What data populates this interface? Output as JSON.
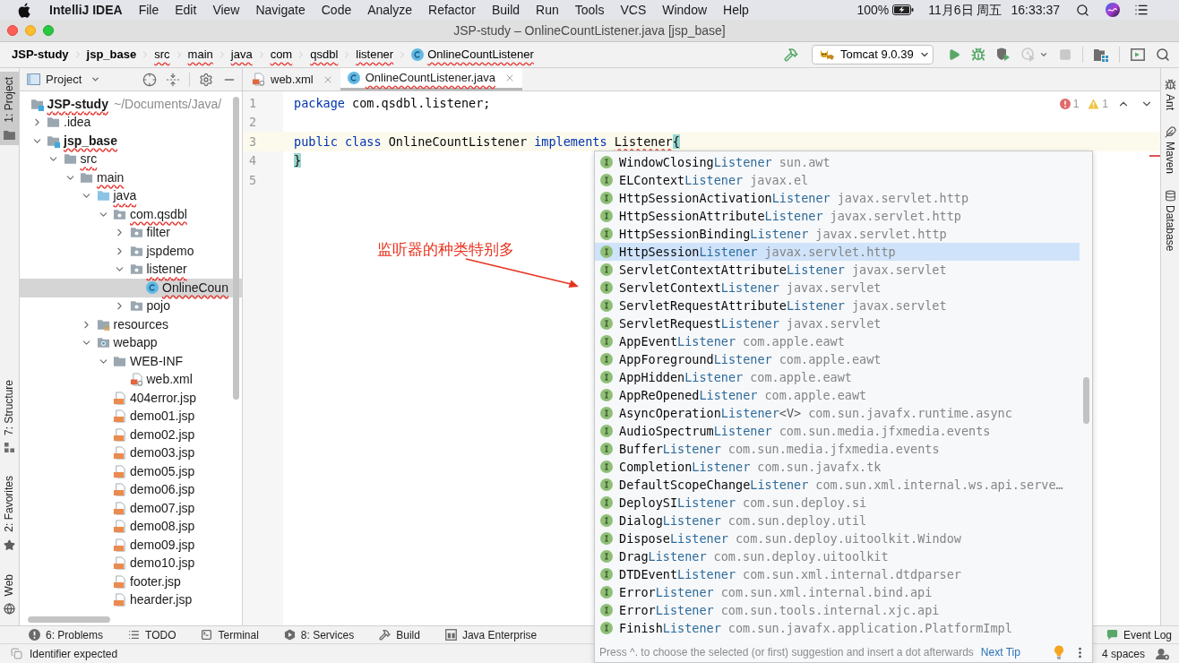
{
  "menu_bar": {
    "app": "IntelliJ IDEA",
    "items": [
      "File",
      "Edit",
      "View",
      "Navigate",
      "Code",
      "Analyze",
      "Refactor",
      "Build",
      "Run",
      "Tools",
      "VCS",
      "Window",
      "Help"
    ],
    "battery": "100%",
    "date": "11月6日 周五",
    "time": "16:33:37"
  },
  "window": {
    "title": "JSP-study – OnlineCountListener.java [jsp_base]"
  },
  "breadcrumbs": [
    {
      "label": "JSP-study",
      "kind": "module",
      "error": false
    },
    {
      "label": "jsp_base",
      "kind": "module",
      "error": false
    },
    {
      "label": "src",
      "kind": "folder",
      "error": true
    },
    {
      "label": "main",
      "kind": "folder",
      "error": true
    },
    {
      "label": "java",
      "kind": "folder",
      "error": true
    },
    {
      "label": "com",
      "kind": "folder",
      "error": true
    },
    {
      "label": "qsdbl",
      "kind": "folder",
      "error": true
    },
    {
      "label": "listener",
      "kind": "folder",
      "error": true
    },
    {
      "label": "OnlineCountListener",
      "kind": "class",
      "error": true
    }
  ],
  "toolbar": [
    {
      "kind": "build",
      "disabled": false
    },
    {
      "kind": "run-config",
      "label": "Tomcat 9.0.39",
      "disabled": false
    },
    {
      "kind": "run",
      "disabled": false
    },
    {
      "kind": "debug",
      "disabled": false
    },
    {
      "kind": "coverage",
      "disabled": false
    },
    {
      "kind": "profile",
      "disabled": true
    },
    {
      "kind": "stop",
      "disabled": true
    },
    {
      "kind": "project-structure",
      "disabled": false
    },
    {
      "kind": "run-window",
      "disabled": false
    },
    {
      "kind": "search",
      "disabled": false
    }
  ],
  "left_strip": {
    "top": [
      {
        "label": "1: Project",
        "kind": "project",
        "selected": true
      }
    ],
    "bottom": [
      {
        "label": "7: Structure",
        "kind": "structure",
        "selected": false
      },
      {
        "label": "2: Favorites",
        "kind": "favorites",
        "selected": false
      },
      {
        "label": "Web",
        "kind": "web",
        "selected": false
      }
    ]
  },
  "project_panel": {
    "title": "Project",
    "tree": [
      {
        "label": "JSP-study",
        "note": "~/Documents/Java/",
        "kind": "module",
        "selected": false,
        "error": true,
        "children": [
          {
            "label": ".idea",
            "kind": "folder",
            "expanded": false,
            "selected": false,
            "error": false
          },
          {
            "label": "jsp_base",
            "kind": "module",
            "expanded": true,
            "selected": false,
            "error": true,
            "children": [
              {
                "label": "src",
                "kind": "folder",
                "expanded": true,
                "selected": false,
                "error": true,
                "children": [
                  {
                    "label": "main",
                    "kind": "folder",
                    "expanded": true,
                    "selected": false,
                    "error": true,
                    "children": [
                      {
                        "label": "java",
                        "kind": "source-root",
                        "expanded": true,
                        "selected": false,
                        "error": true,
                        "children": [
                          {
                            "label": "com.qsdbl",
                            "kind": "package",
                            "expanded": true,
                            "selected": false,
                            "error": true,
                            "children": [
                              {
                                "label": "filter",
                                "kind": "package",
                                "expanded": false,
                                "selected": false,
                                "error": false
                              },
                              {
                                "label": "jspdemo",
                                "kind": "package",
                                "expanded": false,
                                "selected": false,
                                "error": false
                              },
                              {
                                "label": "listener",
                                "kind": "package",
                                "expanded": true,
                                "selected": false,
                                "error": true,
                                "children": [
                                  {
                                    "label": "OnlineCoun",
                                    "kind": "class",
                                    "selected": true,
                                    "error": true
                                  }
                                ]
                              },
                              {
                                "label": "pojo",
                                "kind": "package",
                                "expanded": false,
                                "selected": false,
                                "error": false
                              }
                            ]
                          }
                        ]
                      },
                      {
                        "label": "resources",
                        "kind": "resources-root",
                        "expanded": false,
                        "selected": false,
                        "error": false
                      },
                      {
                        "label": "webapp",
                        "kind": "web-root",
                        "expanded": true,
                        "selected": false,
                        "error": false,
                        "children": [
                          {
                            "label": "WEB-INF",
                            "kind": "folder",
                            "expanded": true,
                            "selected": false,
                            "error": false,
                            "children": [
                              {
                                "label": "web.xml",
                                "kind": "xml",
                                "selected": false,
                                "error": false
                              }
                            ]
                          },
                          {
                            "label": "404error.jsp",
                            "kind": "jsp",
                            "selected": false,
                            "error": false
                          },
                          {
                            "label": "demo01.jsp",
                            "kind": "jsp",
                            "selected": false,
                            "error": false
                          },
                          {
                            "label": "demo02.jsp",
                            "kind": "jsp",
                            "selected": false,
                            "error": false
                          },
                          {
                            "label": "demo03.jsp",
                            "kind": "jsp",
                            "selected": false,
                            "error": false
                          },
                          {
                            "label": "demo05.jsp",
                            "kind": "jsp",
                            "selected": false,
                            "error": false
                          },
                          {
                            "label": "demo06.jsp",
                            "kind": "jsp",
                            "selected": false,
                            "error": false
                          },
                          {
                            "label": "demo07.jsp",
                            "kind": "jsp",
                            "selected": false,
                            "error": false
                          },
                          {
                            "label": "demo08.jsp",
                            "kind": "jsp",
                            "selected": false,
                            "error": false
                          },
                          {
                            "label": "demo09.jsp",
                            "kind": "jsp",
                            "selected": false,
                            "error": false
                          },
                          {
                            "label": "demo10.jsp",
                            "kind": "jsp",
                            "selected": false,
                            "error": false
                          },
                          {
                            "label": "footer.jsp",
                            "kind": "jsp",
                            "selected": false,
                            "error": false
                          },
                          {
                            "label": "hearder.jsp",
                            "kind": "jsp",
                            "selected": false,
                            "error": false
                          }
                        ]
                      }
                    ]
                  }
                ]
              }
            ]
          }
        ]
      }
    ]
  },
  "editor_tabs": [
    {
      "label": "web.xml",
      "kind": "xml",
      "selected": false,
      "error": false
    },
    {
      "label": "OnlineCountListener.java",
      "kind": "class",
      "selected": true,
      "error": true
    }
  ],
  "editor": {
    "errors": "1",
    "warnings": "1",
    "lines": [
      {
        "number": "1",
        "current": false,
        "tokens": [
          {
            "kind": "keyword",
            "text": "package"
          },
          {
            "kind": "plain",
            "text": " com.qsdbl.listener;"
          }
        ]
      },
      {
        "number": "2",
        "current": false
      },
      {
        "number": "3",
        "current": true,
        "tokens": [
          {
            "kind": "keyword",
            "text": "public class"
          },
          {
            "kind": "plain",
            "text": " OnlineCountListener "
          },
          {
            "kind": "keyword",
            "text": "implements "
          },
          {
            "kind": "error",
            "text": "Listener"
          },
          {
            "kind": "brace",
            "text": "{"
          }
        ]
      },
      {
        "number": "4",
        "current": false,
        "tokens": [
          {
            "kind": "brace",
            "text": "}"
          }
        ]
      },
      {
        "number": "5",
        "current": false
      }
    ]
  },
  "annotation": {
    "text": "监听器的种类特别多"
  },
  "completion": {
    "items": [
      {
        "prefix": "WindowClosing",
        "match": "Listener",
        "package": "sun.awt",
        "selected": false
      },
      {
        "prefix": "ELContext",
        "match": "Listener",
        "package": "javax.el",
        "selected": false
      },
      {
        "prefix": "HttpSessionActivation",
        "match": "Listener",
        "package": "javax.servlet.http",
        "selected": false
      },
      {
        "prefix": "HttpSessionAttribute",
        "match": "Listener",
        "package": "javax.servlet.http",
        "selected": false
      },
      {
        "prefix": "HttpSessionBinding",
        "match": "Listener",
        "package": "javax.servlet.http",
        "selected": false
      },
      {
        "prefix": "HttpSession",
        "match": "Listener",
        "package": "javax.servlet.http",
        "selected": true
      },
      {
        "prefix": "ServletContextAttribute",
        "match": "Listener",
        "package": "javax.servlet",
        "selected": false
      },
      {
        "prefix": "ServletContext",
        "match": "Listener",
        "package": "javax.servlet",
        "selected": false
      },
      {
        "prefix": "ServletRequestAttribute",
        "match": "Listener",
        "package": "javax.servlet",
        "selected": false
      },
      {
        "prefix": "ServletRequest",
        "match": "Listener",
        "package": "javax.servlet",
        "selected": false
      },
      {
        "prefix": "AppEvent",
        "match": "Listener",
        "package": "com.apple.eawt",
        "selected": false
      },
      {
        "prefix": "AppForeground",
        "match": "Listener",
        "package": "com.apple.eawt",
        "selected": false
      },
      {
        "prefix": "AppHidden",
        "match": "Listener",
        "package": "com.apple.eawt",
        "selected": false
      },
      {
        "prefix": "AppReOpened",
        "match": "Listener",
        "package": "com.apple.eawt",
        "selected": false
      },
      {
        "prefix": "AsyncOperation",
        "match": "Listener",
        "suffix": "<V>",
        "package": "com.sun.javafx.runtime.async",
        "selected": false
      },
      {
        "prefix": "AudioSpectrum",
        "match": "Listener",
        "package": "com.sun.media.jfxmedia.events",
        "selected": false
      },
      {
        "prefix": "Buffer",
        "match": "Listener",
        "package": "com.sun.media.jfxmedia.events",
        "selected": false
      },
      {
        "prefix": "Completion",
        "match": "Listener",
        "package": "com.sun.javafx.tk",
        "selected": false
      },
      {
        "prefix": "DefaultScopeChange",
        "match": "Listener",
        "package": "com.sun.xml.internal.ws.api.serve…",
        "selected": false
      },
      {
        "prefix": "DeploySI",
        "match": "Listener",
        "package": "com.sun.deploy.si",
        "selected": false
      },
      {
        "prefix": "Dialog",
        "match": "Listener",
        "package": "com.sun.deploy.util",
        "selected": false
      },
      {
        "prefix": "Dispose",
        "match": "Listener",
        "package": "com.sun.deploy.uitoolkit.Window",
        "selected": false
      },
      {
        "prefix": "Drag",
        "match": "Listener",
        "package": "com.sun.deploy.uitoolkit",
        "selected": false
      },
      {
        "prefix": "DTDEvent",
        "match": "Listener",
        "package": "com.sun.xml.internal.dtdparser",
        "selected": false
      },
      {
        "prefix": "Error",
        "match": "Listener",
        "package": "com.sun.xml.internal.bind.api",
        "selected": false
      },
      {
        "prefix": "Error",
        "match": "Listener",
        "package": "com.sun.tools.internal.xjc.api",
        "selected": false
      },
      {
        "prefix": "Finish",
        "match": "Listener",
        "package": "com.sun.javafx.application.PlatformImpl",
        "selected": false
      }
    ],
    "hint": "Press ^. to choose the selected (or first) suggestion and insert a dot afterwards",
    "link": "Next Tip"
  },
  "right_strip": [
    {
      "label": "Ant",
      "kind": "ant",
      "selected": false
    },
    {
      "label": "Maven",
      "kind": "maven",
      "selected": false
    },
    {
      "label": "Database",
      "kind": "database",
      "selected": false
    }
  ],
  "tool_windows": [
    {
      "label": "6: Problems",
      "kind": "problems",
      "selected": false
    },
    {
      "label": "TODO",
      "kind": "todo",
      "selected": false
    },
    {
      "label": "Terminal",
      "kind": "terminal",
      "selected": false
    },
    {
      "label": "8: Services",
      "kind": "services",
      "selected": false
    },
    {
      "label": "Build",
      "kind": "build",
      "selected": false
    },
    {
      "label": "Java Enterprise",
      "kind": "java-enterprise",
      "selected": false
    }
  ],
  "event_log": "Event Log",
  "status_bar": {
    "message": "Identifier expected",
    "indent": "4 spaces"
  }
}
